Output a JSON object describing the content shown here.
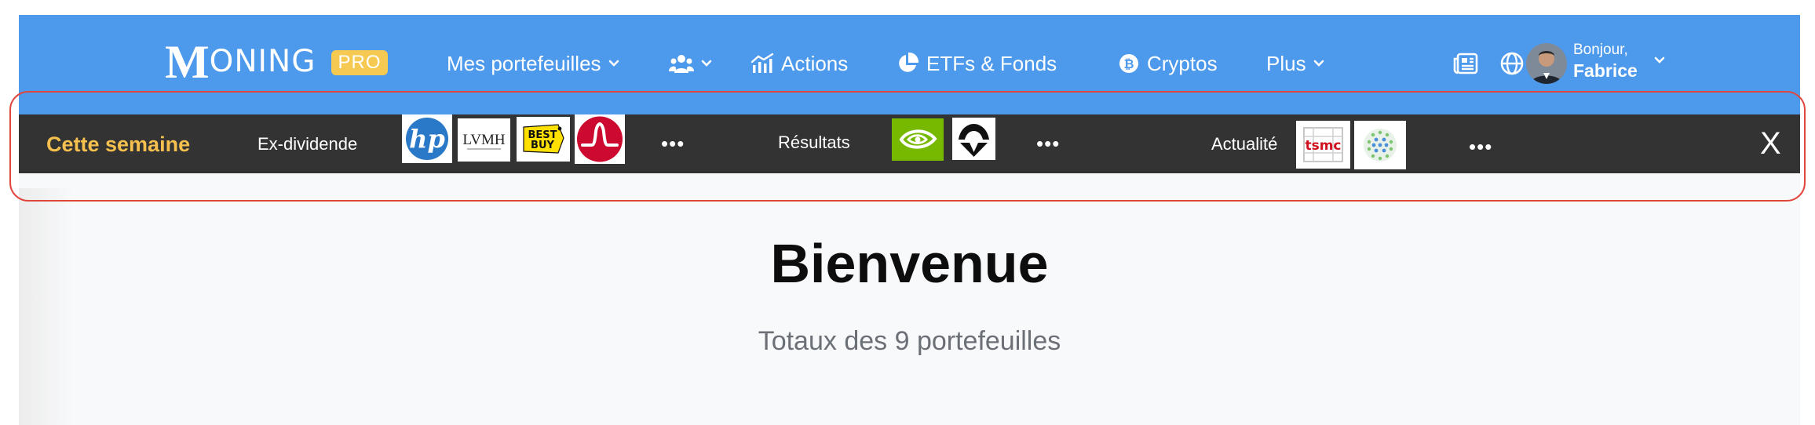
{
  "brand": {
    "logo_m": "M",
    "logo_rest": "ONING",
    "badge": "PRO"
  },
  "nav": {
    "portfolios": "Mes portefeuilles",
    "community_icon": "users-icon",
    "stocks": "Actions",
    "etfs": "ETFs & Fonds",
    "crypto": "Cryptos",
    "more": "Plus",
    "news_icon": "newspaper-icon",
    "language_icon": "globe-icon"
  },
  "user": {
    "greeting": "Bonjour,",
    "name": "Fabrice"
  },
  "this_week": {
    "title": "Cette semaine",
    "ex_dividend": {
      "label": "Ex-dividende",
      "companies": [
        "HP",
        "LVMH",
        "Best Buy",
        "Broadcom"
      ],
      "more": "•••"
    },
    "earnings": {
      "label": "Résultats",
      "companies": [
        "NVIDIA",
        "NIO"
      ],
      "more": "•••"
    },
    "news": {
      "label": "Actualité",
      "companies": [
        "TSMC",
        "Globe logo"
      ],
      "more": "•••"
    },
    "close": "X"
  },
  "logo_text": {
    "hp": "hp",
    "lvmh": "LVMH",
    "bestbuy_1": "BEST",
    "bestbuy_2": "BUY",
    "tsmc": "tsmc"
  },
  "main": {
    "title": "Bienvenue",
    "subtitle": "Totaux des 9 portefeuilles"
  },
  "colors": {
    "navbar": "#4d99eb",
    "strip": "#333333",
    "accent": "#f5c04d",
    "pro_badge": "#f6ca52",
    "highlight": "#e0473c"
  }
}
